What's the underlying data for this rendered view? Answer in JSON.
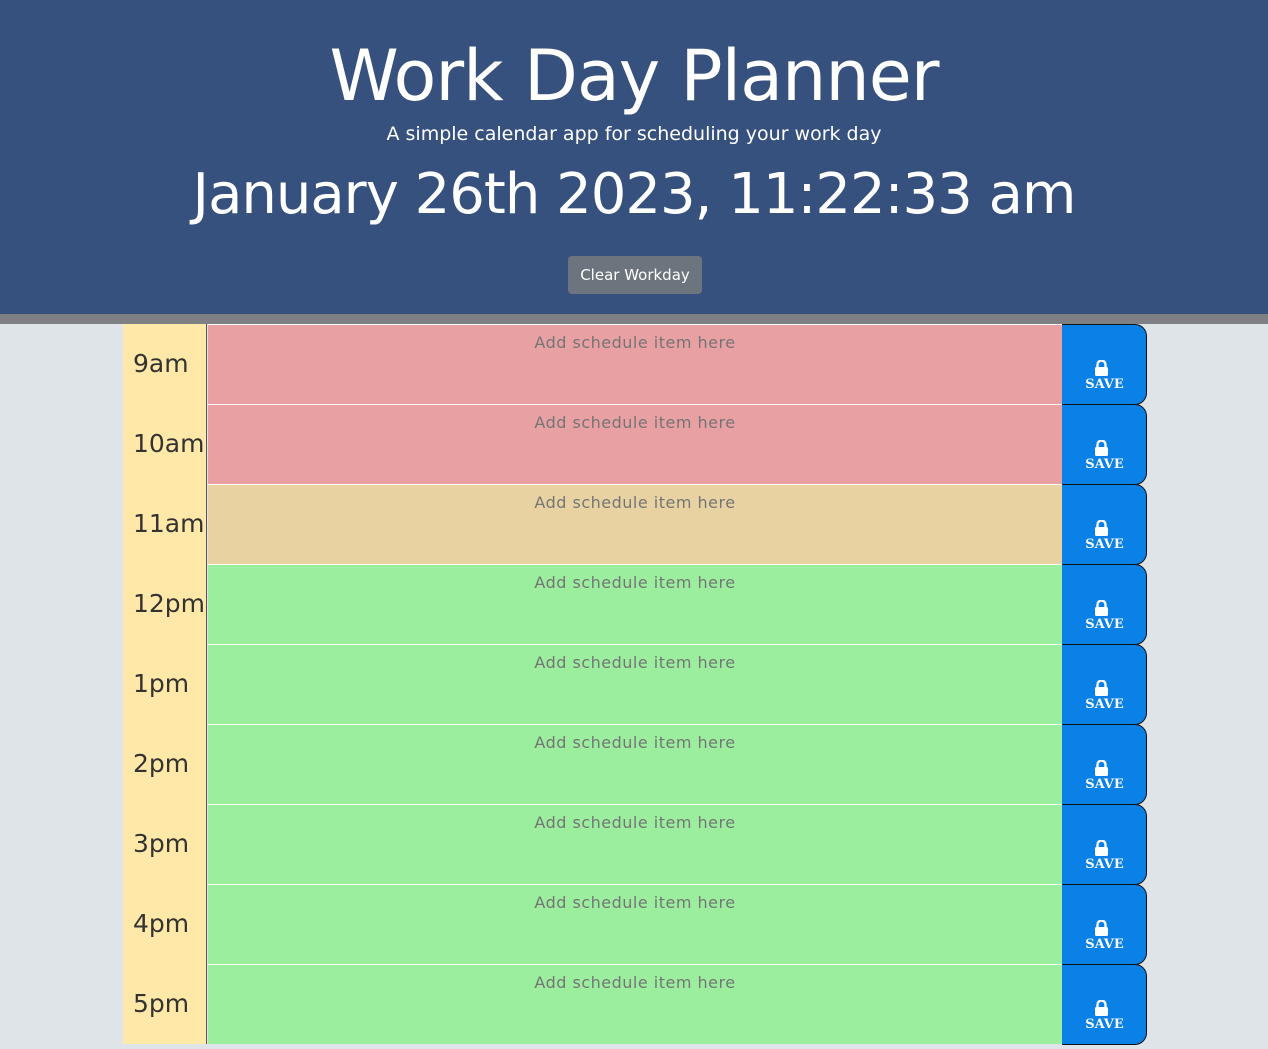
{
  "header": {
    "title": "Work Day Planner",
    "subtitle": "A simple calendar app for scheduling your work day",
    "current_date": "January 26th 2023, 11:22:33 am",
    "clear_button": "Clear Workday"
  },
  "colors": {
    "header_bg": "#36517e",
    "past": "#e8a0a2",
    "present": "#e9d2a2",
    "future": "#9cee9f",
    "save_button": "#0a81e6",
    "hour_bg": "#ffe8a8"
  },
  "placeholder": "Add schedule item here",
  "save_label": "SAVE",
  "save_icon": "lock-icon",
  "rows": [
    {
      "hour": "9am",
      "state": "past",
      "value": ""
    },
    {
      "hour": "10am",
      "state": "past",
      "value": ""
    },
    {
      "hour": "11am",
      "state": "present",
      "value": ""
    },
    {
      "hour": "12pm",
      "state": "future",
      "value": ""
    },
    {
      "hour": "1pm",
      "state": "future",
      "value": ""
    },
    {
      "hour": "2pm",
      "state": "future",
      "value": ""
    },
    {
      "hour": "3pm",
      "state": "future",
      "value": ""
    },
    {
      "hour": "4pm",
      "state": "future",
      "value": ""
    },
    {
      "hour": "5pm",
      "state": "future",
      "value": ""
    }
  ]
}
